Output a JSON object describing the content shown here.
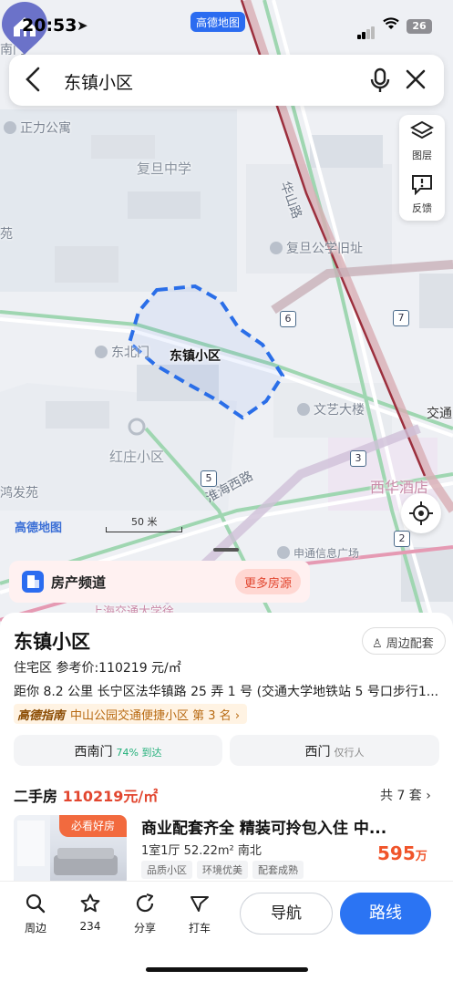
{
  "status_bar": {
    "time": "20:53",
    "app_badge": "高德地图",
    "battery": "26"
  },
  "search": {
    "query": "东镇小区"
  },
  "map_tools": {
    "layers_label": "图层",
    "feedback_label": "反馈"
  },
  "map": {
    "labels": {
      "nanmen": "南门",
      "zhengli": "正力公寓",
      "fudan_middle": "复旦中学",
      "huashan_road": "华山路",
      "fudan_apt": "复旦公学旧址",
      "yuan": "苑",
      "dongbeimen": "东北门",
      "hongzhuang": "红庄小区",
      "wenyi": "文艺大楼",
      "jiaotong": "交通",
      "xihua": "西华酒店",
      "yingfa": "鸿发苑",
      "huaihai": "淮海西路",
      "shentong": "申通信息广场",
      "sjtu": "上海交通大学徐"
    },
    "metro": {
      "m6": "6",
      "m7": "7",
      "m5": "5",
      "m3": "3",
      "m2": "2"
    },
    "pin_label": "东镇小区",
    "watermark": "高德地图",
    "scale": "50 米"
  },
  "banner": {
    "title": "房产频道",
    "more": "更多房源"
  },
  "place": {
    "name": "东镇小区",
    "nearby": "周边配套",
    "sub": "住宅区  参考价:110219 元/㎡",
    "address": "距你 8.2 公里  长宁区法华镇路 25 弄 1 号 (交通大学地铁站 5 号口步行1...",
    "guide_brand": "高德指南",
    "guide_text": "中山公园交通便捷小区 第 3 名 ›",
    "gates": [
      {
        "name": "西南门",
        "note": "74% 到达"
      },
      {
        "name": "西门",
        "note": "仅行人"
      }
    ]
  },
  "listing": {
    "heading": "二手房",
    "heading_price": "110219元/㎡",
    "count": "共 7 套 ›",
    "tag": "必看好房",
    "title": "商业配套齐全 精装可拎包入住 中...",
    "spec": "1室1厅  52.22m²  南北",
    "price": "595",
    "price_unit": "万",
    "chips": [
      "品质小区",
      "环境优美",
      "配套成熟"
    ]
  },
  "toolbar": {
    "nearby": "周边",
    "favorites": "234",
    "share": "分享",
    "taxi": "打车",
    "navigate": "导航",
    "route": "路线"
  }
}
